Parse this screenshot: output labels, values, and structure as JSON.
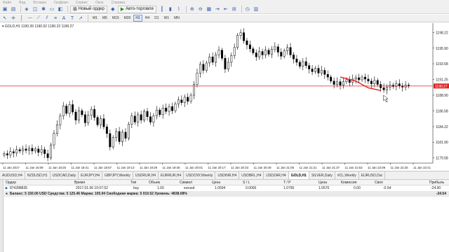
{
  "menu": [
    "Файл",
    "Вид",
    "Вставка",
    "Графики",
    "Сервис",
    "Окно",
    "Справка"
  ],
  "toolbar": {
    "new_order_label": "Новый ордер",
    "autotrading_label": "Авто-торговля",
    "icons": [
      "new-chart-icon",
      "profiles-icon",
      "market-watch-icon",
      "data-window-icon",
      "navigator-icon",
      "terminal-icon",
      "tester-icon",
      "new-order-icon",
      "metaeditor-icon",
      "autotrading-icon",
      "bar-chart-icon",
      "candles-icon",
      "line-chart-icon",
      "zoom-in-icon",
      "zoom-out-icon",
      "tile-icon",
      "autoscroll-icon",
      "chart-shift-icon",
      "indicators-icon",
      "periods-icon",
      "templates-icon"
    ]
  },
  "timeframes": [
    "M1",
    "M5",
    "M15",
    "M30",
    "H1",
    "H4",
    "D1",
    "W1",
    "MN"
  ],
  "active_timeframe": "H1",
  "chart": {
    "title": "GOLD,H1  1190.39 1190.52 1190.22 1190.27",
    "current_price_label": "1190.27",
    "hline_color": "#e02020",
    "up_color": "#000000",
    "down_color": "#000000",
    "grid": false
  },
  "chart_data": {
    "type": "candlestick",
    "symbol": "GOLD",
    "timeframe": "H1",
    "y_ticks": [
      1179.58,
      1181.9,
      1184.22,
      1186.58,
      1188.9,
      1191.25,
      1193.58,
      1195.9,
      1198.22
    ],
    "ylim": [
      1178.8,
      1199.0
    ],
    "x_ticks": [
      "11 Jan 2017",
      "11 Jan 16:09",
      "11 Jan 18:25",
      "11 Jan 18:41",
      "11 Jan 18:57",
      "11 Jan 19:13",
      "11 Jan 19:29",
      "11 Jan 19:45",
      "11 Jan 20:01",
      "11 Jan 20:17",
      "11 Jan 20:33",
      "11 Jan 20:49",
      "11 Jan 21:05",
      "11 Jan 21:21",
      "11 Jan 21:37",
      "11 Jan 21:53",
      "11 Jan 22:09",
      "11 Jan 22:25",
      "11 Jan 22:41"
    ],
    "close_path": [
      1180.2,
      1180.0,
      1180.5,
      1180.3,
      1180.8,
      1180.6,
      1180.9,
      1180.7,
      1181.0,
      1180.6,
      1180.9,
      1180.4,
      1180.8,
      1180.2,
      1179.6,
      1181.5,
      1183.2,
      1184.5,
      1185.8,
      1187.3,
      1186.2,
      1187.5,
      1186.4,
      1185.2,
      1186.6,
      1186.0,
      1184.8,
      1185.9,
      1186.8,
      1185.6,
      1184.5,
      1185.4,
      1184.2,
      1183.2,
      1181.2,
      1182.6,
      1183.5,
      1182.0,
      1183.4,
      1182.5,
      1184.6,
      1185.8,
      1184.9,
      1186.0,
      1185.2,
      1186.5,
      1185.7,
      1184.9,
      1185.8,
      1186.7,
      1186.0,
      1187.0,
      1186.5,
      1187.2,
      1186.6,
      1187.6,
      1188.2,
      1187.8,
      1188.6,
      1188.0,
      1188.9,
      1190.5,
      1192.2,
      1193.5,
      1192.6,
      1193.7,
      1194.6,
      1193.8,
      1194.9,
      1195.6,
      1194.4,
      1192.8,
      1193.8,
      1194.8,
      1196.0,
      1197.8,
      1198.2,
      1197.0,
      1196.4,
      1195.8,
      1195.2,
      1194.6,
      1195.4,
      1194.9,
      1195.6,
      1195.0,
      1195.7,
      1196.1,
      1195.3,
      1194.7,
      1195.5,
      1196.0,
      1194.9,
      1194.3,
      1193.8,
      1193.2,
      1193.9,
      1193.3,
      1192.8,
      1192.4,
      1192.9,
      1192.2,
      1192.6,
      1192.0,
      1191.6,
      1191.0,
      1190.5,
      1190.9,
      1190.4,
      1190.9,
      1191.2,
      1190.8,
      1191.3,
      1191.5,
      1191.2,
      1191.6,
      1191.3,
      1191.0,
      1190.6,
      1191.1,
      1190.5,
      1190.0,
      1189.7,
      1190.1,
      1190.4,
      1190.2,
      1190.6,
      1190.3,
      1190.1,
      1190.4,
      1190.27
    ],
    "red_line": [
      [
        108,
        1191.6
      ],
      [
        113,
        1191.0
      ],
      [
        117,
        1190.0
      ],
      [
        121,
        1189.6
      ]
    ],
    "hline_value": 1190.27
  },
  "tabs": [
    "AUDUSD,H4",
    "NZDUSD,H1",
    "USDCAD,Daily",
    "EURJPY,H4",
    "GBPJPY,Weekly",
    "USDRUR,H4",
    "EURRUR,H4",
    "USDCNY,Weekly",
    "USDINR,H4",
    "USDBRL,H4",
    "USDZAR,H4",
    "GOLD,H1",
    "SILVER,Daily",
    "#CL,Weekly",
    "EURUSD,Dai"
  ],
  "active_tab": "GOLD,H1",
  "terminal": {
    "headers": [
      "Ордер",
      "Время",
      "Тип",
      "Объем",
      "Символ",
      "Цена",
      "S / L",
      "T / P",
      "Цена",
      "Комиссия",
      "Своп",
      "Прибыль"
    ],
    "row": [
      "874288835",
      "2017.01.06 10:07:52",
      "buy",
      "1.00",
      "eurusd",
      "1.0594",
      "0.0000",
      "1.0790",
      "1.0570",
      "0.00",
      "-0.54",
      "-24.00"
    ],
    "balance": "Баланс: 5 150.00 USD  Средства: 5 125.46  Маржа: 105.94  Свободная маржа: 5 019.52  Уровень: 4838.08%",
    "balance_total": "-24.54"
  }
}
